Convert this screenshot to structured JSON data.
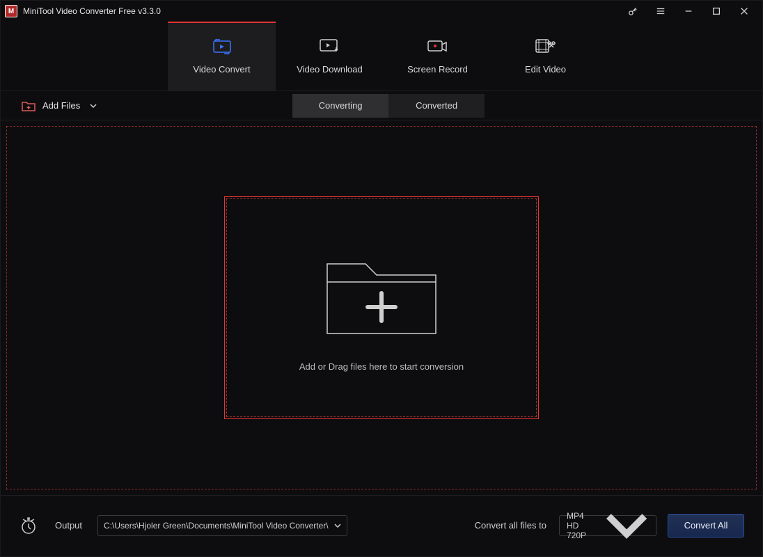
{
  "app": {
    "title": "MiniTool Video Converter Free v3.3.0"
  },
  "nav": {
    "items": [
      {
        "label": "Video Convert"
      },
      {
        "label": "Video Download"
      },
      {
        "label": "Screen Record"
      },
      {
        "label": "Edit Video"
      }
    ]
  },
  "toolbar": {
    "add_files_label": "Add Files",
    "segments": {
      "converting": "Converting",
      "converted": "Converted"
    }
  },
  "dropzone": {
    "hint": "Add or Drag files here to start conversion"
  },
  "footer": {
    "output_label": "Output",
    "output_path": "C:\\Users\\Hjoler Green\\Documents\\MiniTool Video Converter\\",
    "convert_to_label": "Convert all files to",
    "format": "MP4 HD 720P",
    "convert_all": "Convert All"
  }
}
